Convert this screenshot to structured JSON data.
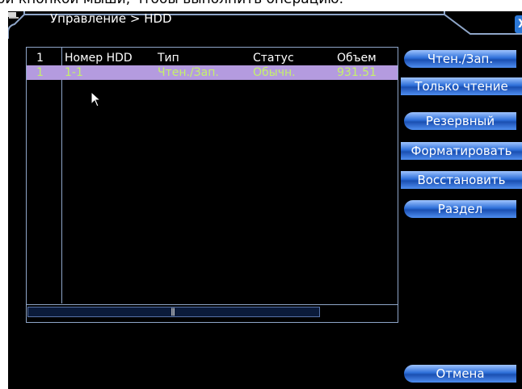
{
  "caption": "ой кнопкой мыши, чтобы выполнить операцию.",
  "window": {
    "title": "Управление > HDD",
    "close_label": "X"
  },
  "table": {
    "header": {
      "index": "1",
      "hdd_number": "Номер HDD",
      "type": "Тип",
      "status": "Статус",
      "size": "Объем"
    },
    "rows": [
      {
        "index": "1",
        "hdd_number": "1-1",
        "type": "Чтен./Зап.",
        "status": "Обычн.",
        "size": "931.51"
      }
    ],
    "scroll_grip": "|||"
  },
  "buttons": {
    "read_write": "Чтен./Зап.",
    "read_only": "Только чтение",
    "backup": "Резервный",
    "format": "Форматировать",
    "restore": "Восстановить",
    "partition": "Раздел",
    "cancel": "Отмена"
  },
  "colors": {
    "selected_row_bg": "#b49bdf",
    "selected_row_text": "#c5f26a",
    "button_blue": "#2d6fd8"
  }
}
